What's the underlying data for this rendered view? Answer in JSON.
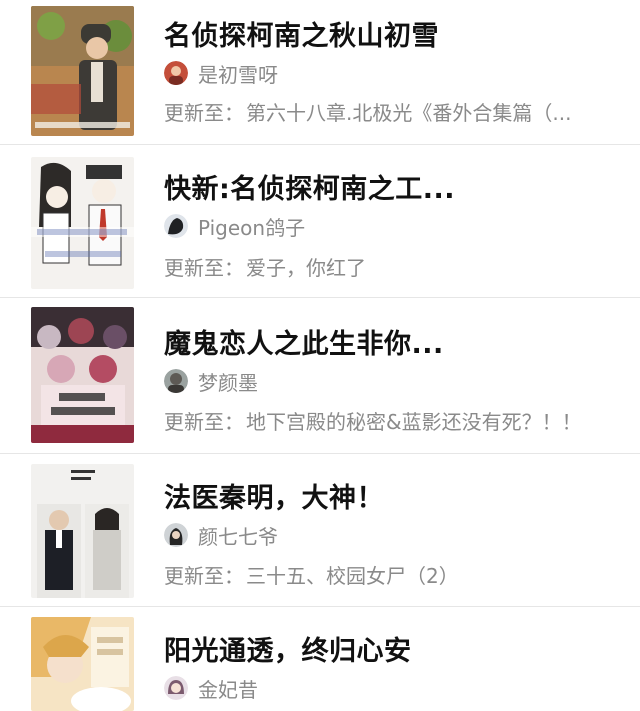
{
  "books": [
    {
      "title": "名侦探柯南之秋山初雪",
      "author": "是初雪呀",
      "update_prefix": "更新至：",
      "update_text": "第六十八章.北极光《番外合集篇（...",
      "cover_icon": "detective-conan-cover",
      "avatar_icon": "author-avatar-red"
    },
    {
      "title": "快新:名侦探柯南之工...",
      "author": "Pigeon鸽子",
      "update_prefix": "更新至：",
      "update_text": "爱子，你红了",
      "cover_icon": "kaishin-cover",
      "avatar_icon": "author-avatar-dark"
    },
    {
      "title": "魔鬼恋人之此生非你...",
      "author": "梦颜墨",
      "update_prefix": "更新至：",
      "update_text": "地下宫殿的秘密&蓝影还没有死？！！",
      "cover_icon": "diabolik-lovers-cover",
      "avatar_icon": "author-avatar-grey"
    },
    {
      "title": "法医秦明，大神！",
      "author": "颜七七爷",
      "update_prefix": "更新至：",
      "update_text": "三十五、校园女尸（2）",
      "cover_icon": "forensic-qinming-cover",
      "avatar_icon": "author-avatar-dark"
    },
    {
      "title": "阳光通透，终归心安",
      "author": "金妃昔",
      "update_prefix": "",
      "update_text": "",
      "cover_icon": "sunshine-cover",
      "avatar_icon": "author-avatar-anime"
    }
  ]
}
